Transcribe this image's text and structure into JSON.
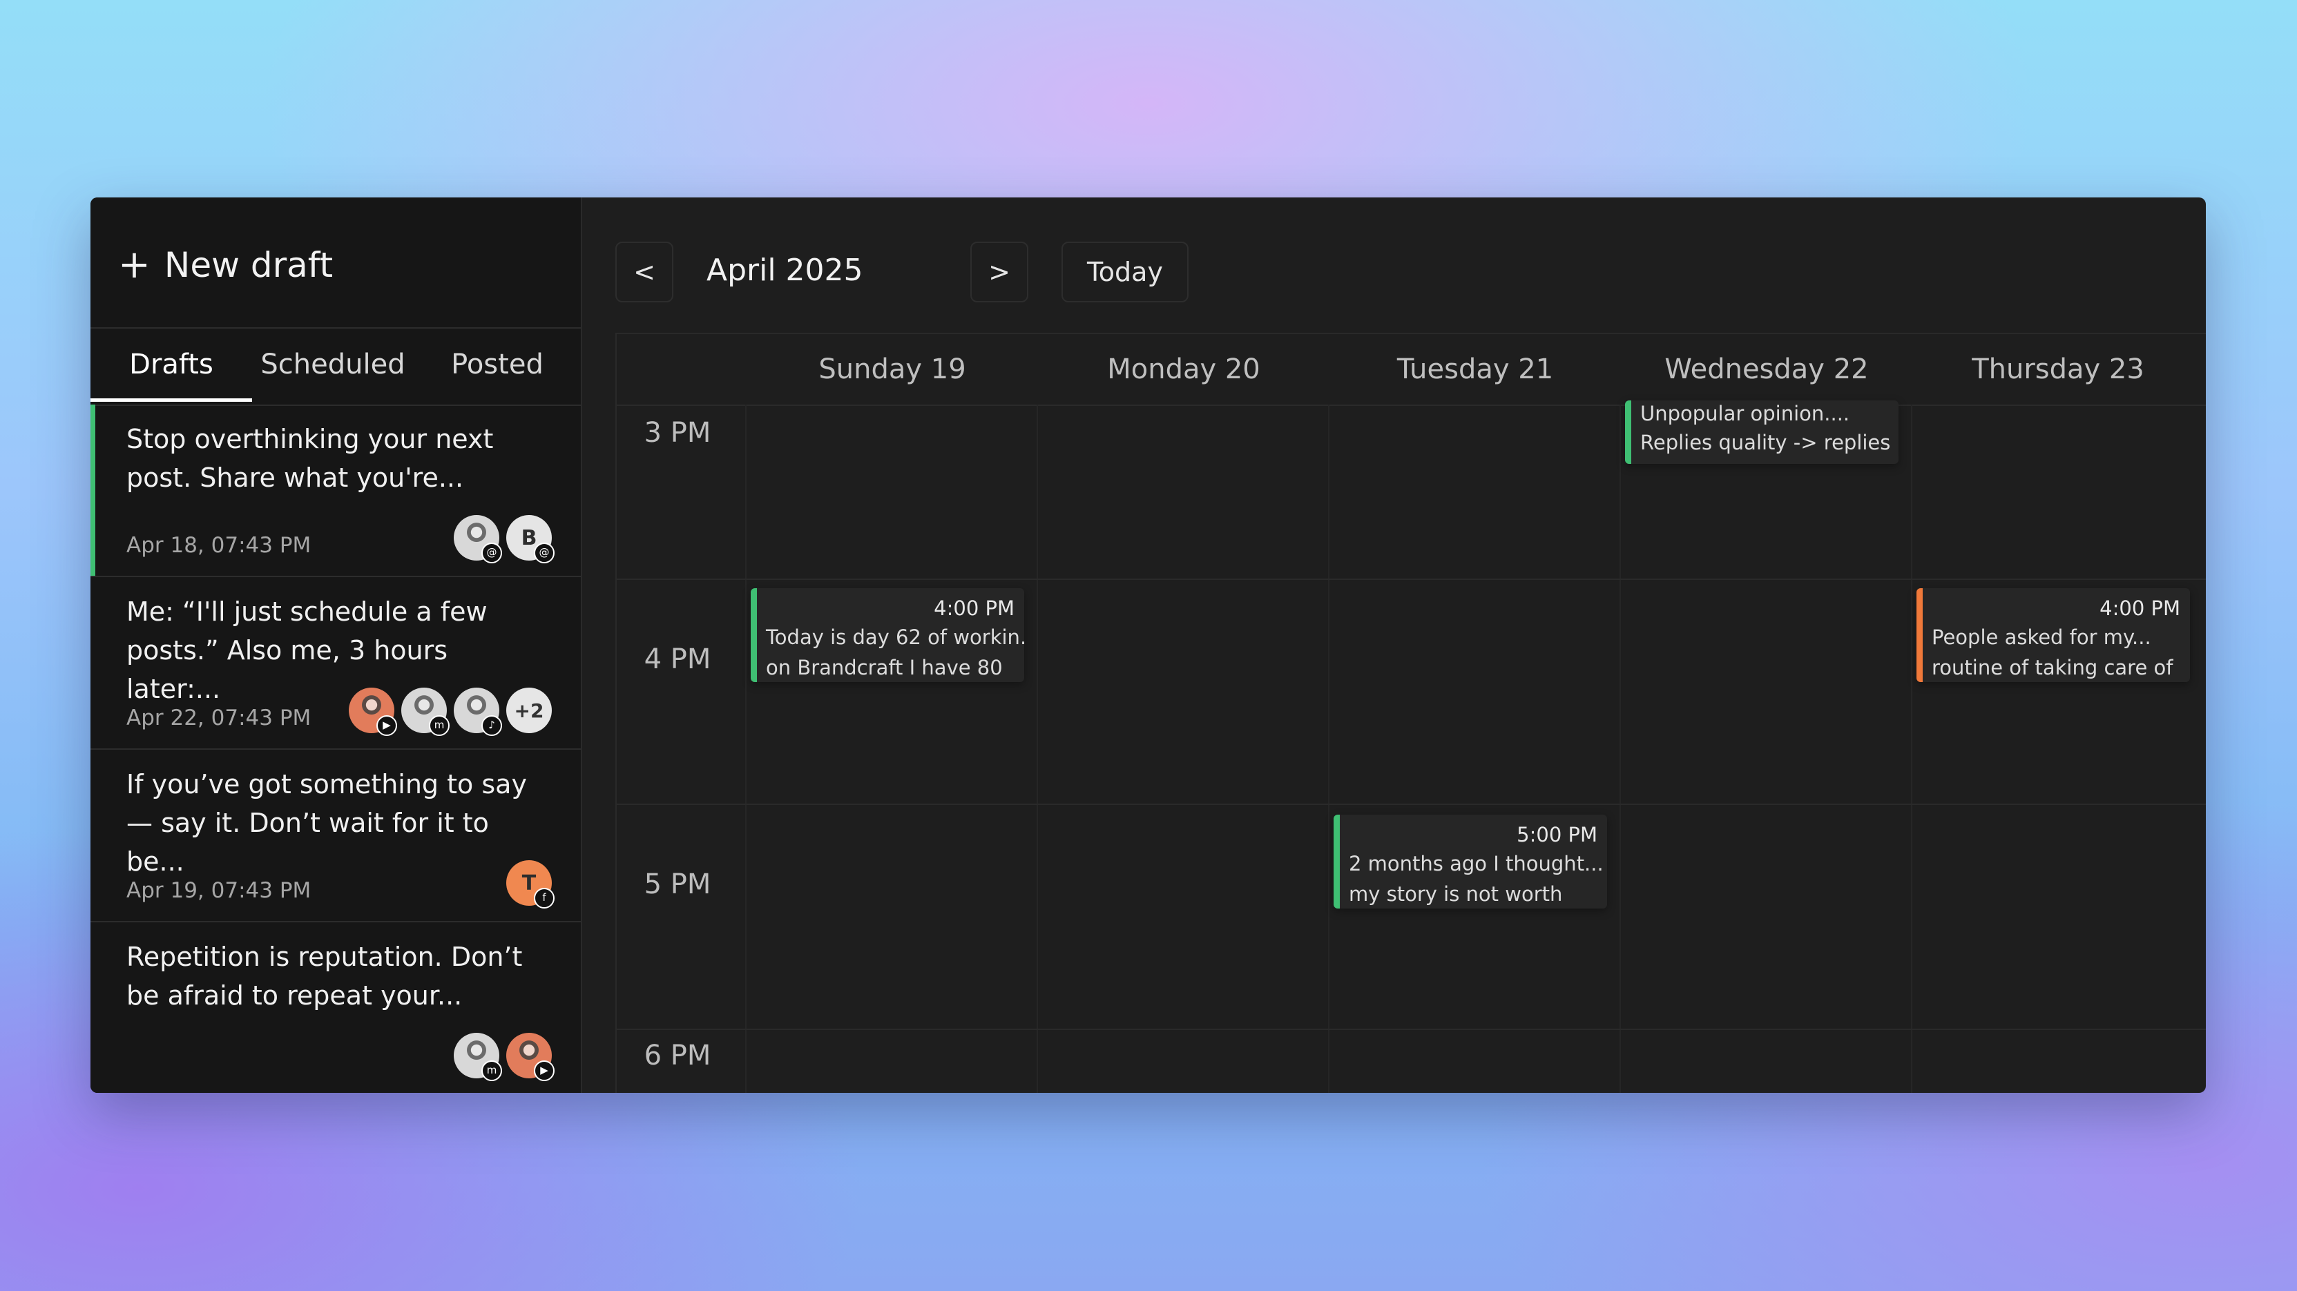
{
  "sidebar": {
    "new_draft_label": "New draft",
    "tabs": [
      {
        "label": "Drafts",
        "active": true
      },
      {
        "label": "Scheduled",
        "active": false
      },
      {
        "label": "Posted",
        "active": false
      }
    ],
    "cards": [
      {
        "text": "Stop overthinking your next post. Share what you're...",
        "date": "Apr 18, 07:43 PM",
        "avatars": [
          {
            "type": "photo",
            "badge_icon": "threads-icon"
          },
          {
            "type": "letter",
            "letter": "B",
            "badge_icon": "threads-icon"
          }
        ]
      },
      {
        "text": "Me: “I'll just schedule a few posts.” Also me, 3 hours later:...",
        "date": "Apr 22, 07:43 PM",
        "avatars": [
          {
            "type": "photo2",
            "badge_icon": "youtube-icon"
          },
          {
            "type": "photo",
            "badge_icon": "mastodon-icon"
          },
          {
            "type": "photo",
            "badge_icon": "tiktok-icon"
          }
        ],
        "more": "+2"
      },
      {
        "text": "If you’ve got something to say — say it. Don’t wait for it to be...",
        "date": "Apr 19, 07:43 PM",
        "avatars": [
          {
            "type": "orange",
            "letter": "T",
            "badge_icon": "facebook-icon"
          }
        ]
      },
      {
        "text": "Repetition is reputation. Don’t be afraid to repeat your...",
        "date": "",
        "avatars": [
          {
            "type": "photo",
            "badge_icon": "mastodon-icon"
          },
          {
            "type": "photo2",
            "badge_icon": "youtube-icon"
          }
        ]
      }
    ]
  },
  "calendar": {
    "prev_label": "<",
    "next_label": ">",
    "month": "April 2025",
    "today_label": "Today",
    "days": [
      "Sunday 19",
      "Monday 20",
      "Tuesday 21",
      "Wednesday 22",
      "Thursday 23"
    ],
    "times": [
      "3 PM",
      "4 PM",
      "5 PM",
      "6 PM"
    ],
    "events": [
      {
        "day": "Wednesday 22",
        "time": "",
        "line1": "Unpopular opinion....",
        "line2": "Replies quality -> replies",
        "color": "#3fbf73"
      },
      {
        "day": "Sunday 19",
        "time": "4:00 PM",
        "line1": "Today is day 62 of workin...",
        "line2": "on Brandcraft I have 80",
        "color": "#3fbf73"
      },
      {
        "day": "Thursday 23",
        "time": "4:00 PM",
        "line1": "People asked for my...",
        "line2": "routine of taking care of",
        "color": "#f0793a"
      },
      {
        "day": "Tuesday 21",
        "time": "5:00 PM",
        "line1": "2 months ago I thought...",
        "line2": "my story is not worth",
        "color": "#3fbf73"
      }
    ]
  }
}
